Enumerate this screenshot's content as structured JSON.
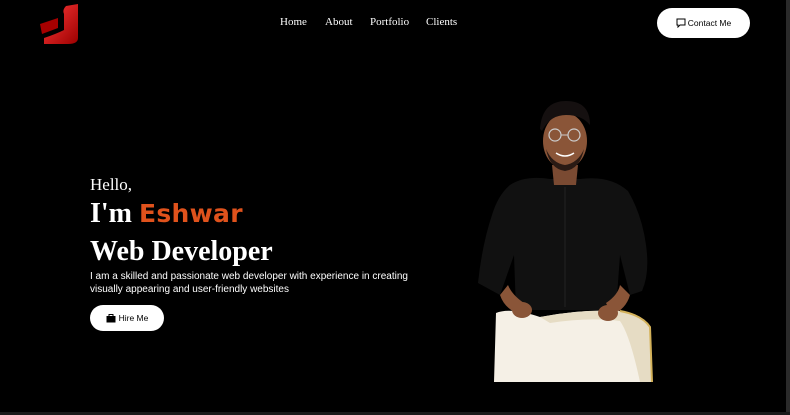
{
  "header": {
    "nav": [
      "Home",
      "About",
      "Portfolio",
      "Clients"
    ],
    "contact_label": "Contact Me"
  },
  "hero": {
    "greeting": "Hello,",
    "im_prefix": "I'm",
    "name": "Eshwar",
    "role": "Web Developer",
    "description": "I am a skilled and passionate web developer with experience in creating visually appearing and user-friendly websites",
    "hire_label": "Hire Me"
  },
  "colors": {
    "background": "#000000",
    "accent": "#e0521c",
    "button_bg": "#ffffff"
  },
  "icons": {
    "logo": "brand-logo",
    "contact": "message-icon",
    "hire": "briefcase-icon"
  }
}
